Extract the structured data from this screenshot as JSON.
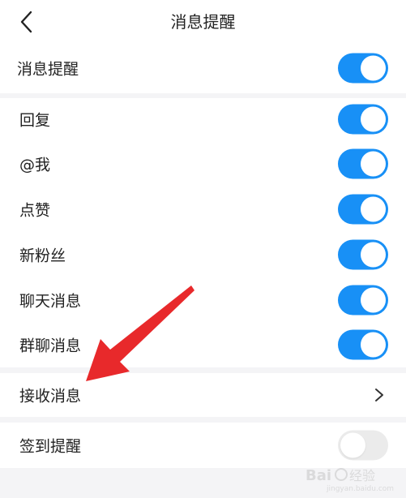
{
  "header": {
    "title": "消息提醒"
  },
  "main_toggle": {
    "label": "消息提醒",
    "on": true
  },
  "settings": [
    {
      "label": "回复",
      "on": true
    },
    {
      "label": "@我",
      "on": true
    },
    {
      "label": "点赞",
      "on": true
    },
    {
      "label": "新粉丝",
      "on": true
    },
    {
      "label": "聊天消息",
      "on": true
    },
    {
      "label": "群聊消息",
      "on": true
    }
  ],
  "receive": {
    "label": "接收消息"
  },
  "checkin": {
    "label": "签到提醒",
    "on": false
  },
  "watermark": {
    "text": "Baidu经验",
    "sub": "jingyan.baidu.com"
  },
  "colors": {
    "toggle_on": "#1890f6",
    "toggle_off": "#ebebeb",
    "annotation_arrow": "#e8292b"
  }
}
